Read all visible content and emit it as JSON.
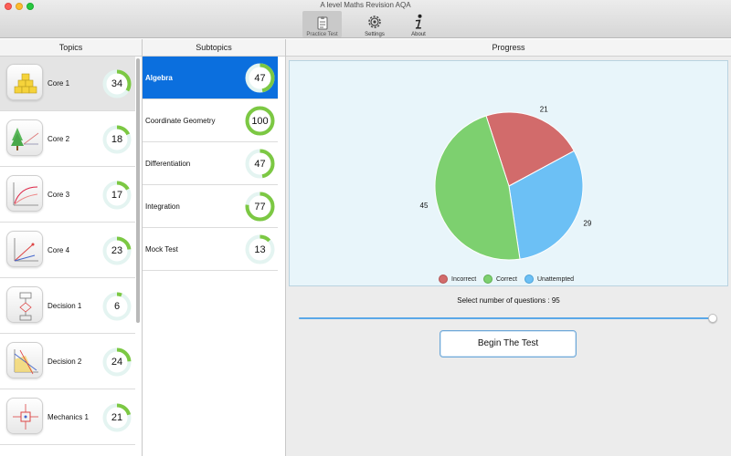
{
  "window": {
    "title": "A level Maths Revision AQA"
  },
  "toolbar": {
    "practice_label": "Practice Test",
    "settings_label": "Settings",
    "about_label": "About"
  },
  "columns": {
    "topics": "Topics",
    "subtopics": "Subtopics",
    "progress": "Progress"
  },
  "colors": {
    "ring_green": "#7cc843",
    "ring_track": "#e4f4f1",
    "selected_blue": "#0b6fde"
  },
  "topics": [
    {
      "label": "Core 1",
      "value": "34",
      "percent": 34,
      "icon": "pyramid-blocks-icon"
    },
    {
      "label": "Core 2",
      "value": "18",
      "percent": 18,
      "icon": "tree-diagram-icon"
    },
    {
      "label": "Core 3",
      "value": "17",
      "percent": 17,
      "icon": "curve-graph-icon"
    },
    {
      "label": "Core 4",
      "value": "23",
      "percent": 23,
      "icon": "vector-graph-icon"
    },
    {
      "label": "Decision 1",
      "value": "6",
      "percent": 6,
      "icon": "flowchart-icon"
    },
    {
      "label": "Decision 2",
      "value": "24",
      "percent": 24,
      "icon": "linear-programming-icon"
    },
    {
      "label": "Mechanics 1",
      "value": "21",
      "percent": 21,
      "icon": "forces-icon"
    }
  ],
  "subtopics": [
    {
      "label": "Algebra",
      "value": "47",
      "percent": 47
    },
    {
      "label": "Coordinate Geometry",
      "value": "100",
      "percent": 100
    },
    {
      "label": "Differentiation",
      "value": "47",
      "percent": 47
    },
    {
      "label": "Integration",
      "value": "77",
      "percent": 77
    },
    {
      "label": "Mock Test",
      "value": "13",
      "percent": 13
    }
  ],
  "chart_data": {
    "type": "pie",
    "slices": [
      {
        "name": "Incorrect",
        "value": 21,
        "color": "#d26b6b"
      },
      {
        "name": "Correct",
        "value": 45,
        "color": "#7dd06f"
      },
      {
        "name": "Unattempted",
        "value": 29,
        "color": "#6cc0f5"
      }
    ],
    "legend": "bottom"
  },
  "quiz": {
    "select_label": "Select number of questions : 95",
    "slider_fraction": 1.0,
    "begin_label": "Begin The Test"
  }
}
